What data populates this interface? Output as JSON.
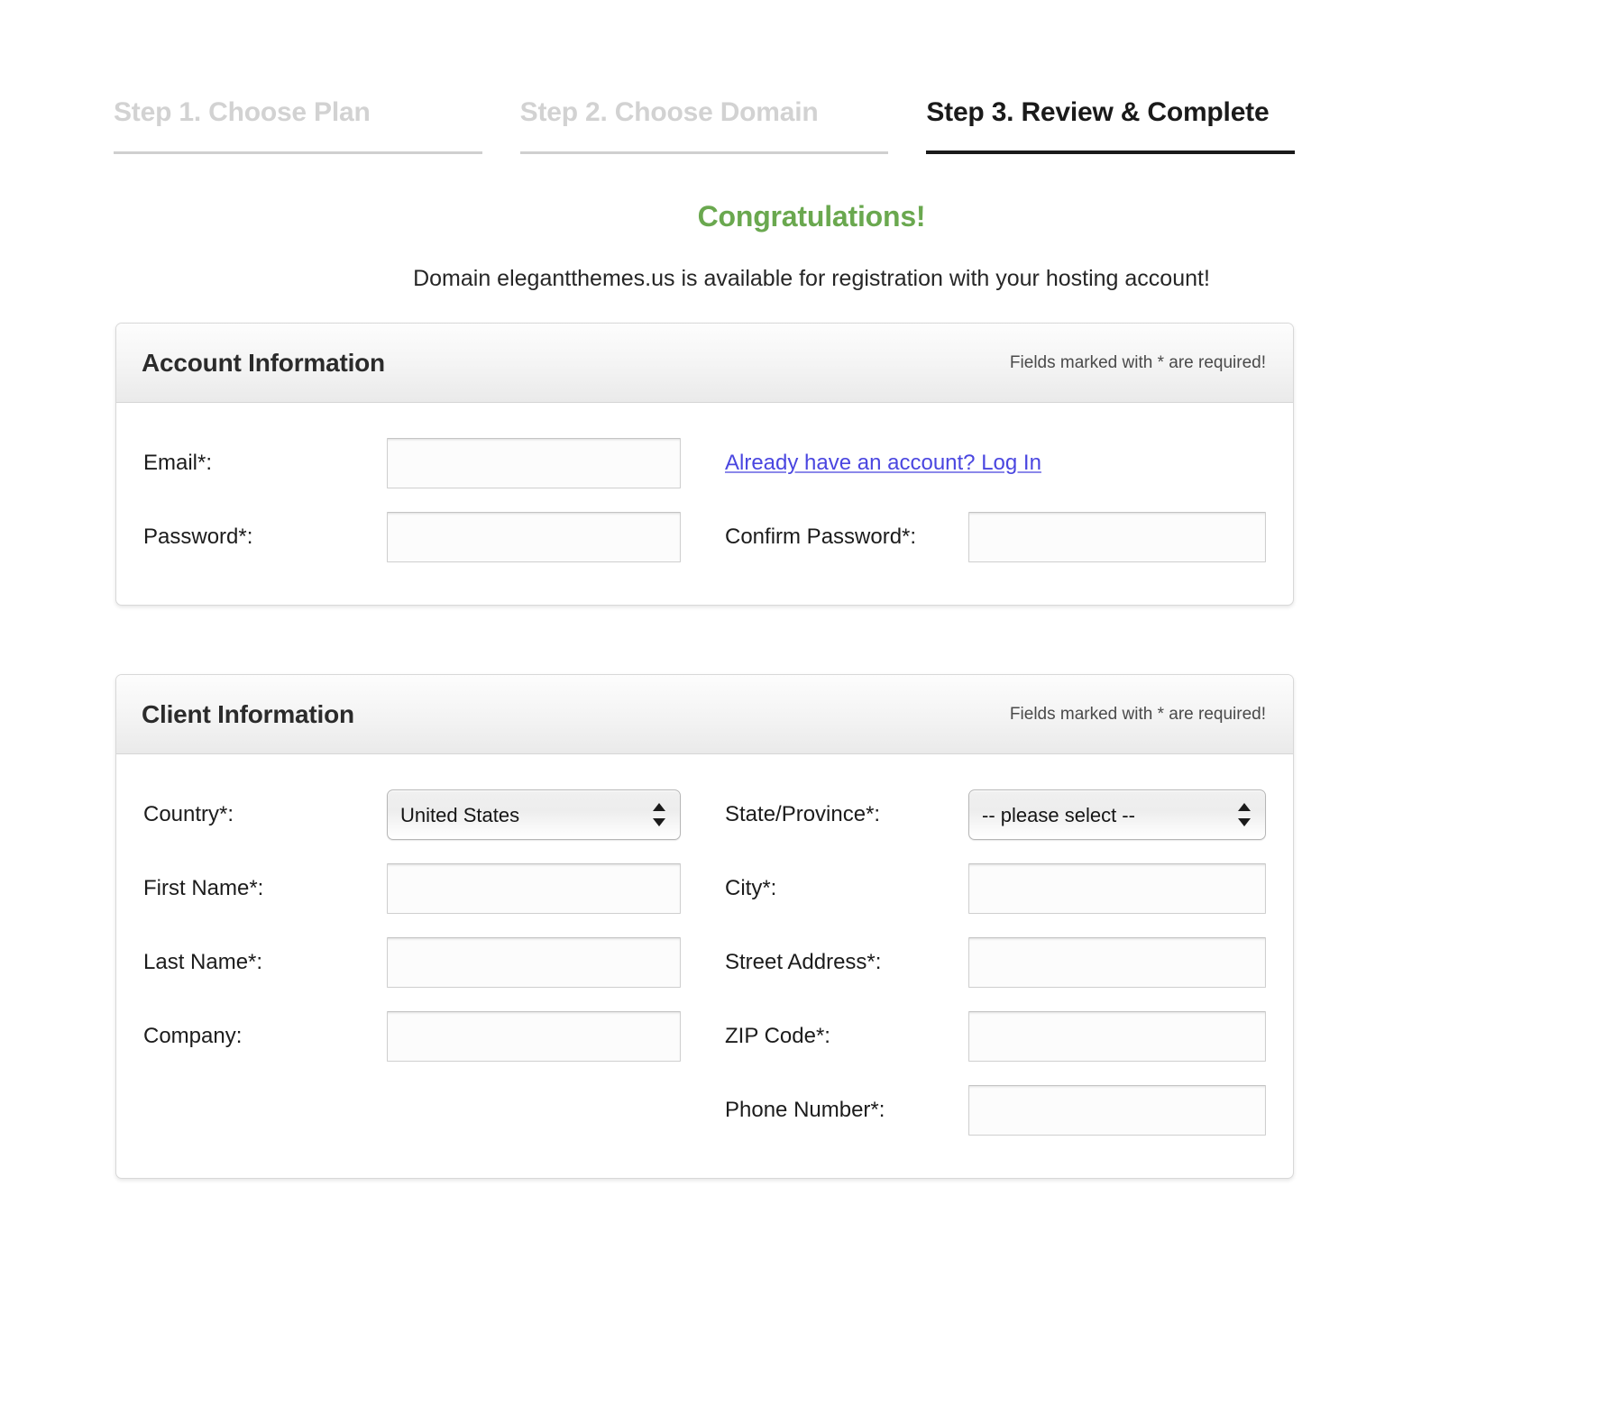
{
  "steps": [
    {
      "label": "Step 1. Choose Plan",
      "state": "inactive"
    },
    {
      "label": "Step 2. Choose Domain",
      "state": "inactive"
    },
    {
      "label": "Step 3. Review & Complete",
      "state": "active"
    }
  ],
  "headline": {
    "congratulations": "Congratulations!",
    "availability": "Domain elegantthemes.us is available for registration with your hosting account!",
    "congratulations_color": "#6aa84f"
  },
  "account_panel": {
    "title": "Account Information",
    "required_note": "Fields marked with * are required!",
    "fields": {
      "email_label": "Email*:",
      "email_value": "",
      "password_label": "Password*:",
      "password_value": "",
      "confirm_password_label": "Confirm Password*:",
      "confirm_password_value": ""
    },
    "login_link": "Already have an account? Log In",
    "login_link_color": "#4a46e0"
  },
  "client_panel": {
    "title": "Client Information",
    "required_note": "Fields marked with * are required!",
    "fields": {
      "country_label": "Country*:",
      "country_value": "United States",
      "state_label": "State/Province*:",
      "state_value": "-- please select --",
      "first_name_label": "First Name*:",
      "first_name_value": "",
      "city_label": "City*:",
      "city_value": "",
      "last_name_label": "Last Name*:",
      "last_name_value": "",
      "street_label": "Street Address*:",
      "street_value": "",
      "company_label": "Company:",
      "company_value": "",
      "zip_label": "ZIP Code*:",
      "zip_value": "",
      "phone_label": "Phone Number*:",
      "phone_value": ""
    },
    "country_options": [
      "United States"
    ],
    "state_options": [
      "-- please select --"
    ]
  },
  "icons": {
    "select_arrow": "up-down-arrow-icon"
  }
}
